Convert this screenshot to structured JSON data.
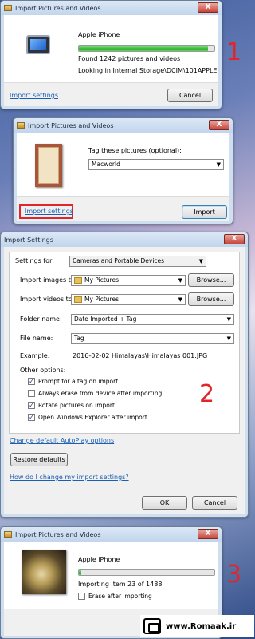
{
  "dialog1": {
    "title": "Import Pictures and Videos",
    "close": "X",
    "device": "Apple iPhone",
    "progress": 0.95,
    "found": "Found 1242 pictures and videos",
    "looking": "Looking in Internal Storage\\DCIM\\101APPLE",
    "import_settings": "Import settings",
    "cancel": "Cancel",
    "step": "1"
  },
  "dialog2": {
    "title": "Import Pictures and Videos",
    "close": "X",
    "tag_label": "Tag these pictures (optional):",
    "tag_value": "Macworld",
    "import_settings": "Import settings",
    "import": "Import",
    "highlight_color": "#e0262b"
  },
  "dialog3": {
    "title": "Import Settings",
    "close": "X",
    "settings_for_label": "Settings for:",
    "settings_for_value": "Cameras and Portable Devices",
    "import_images_label": "Import images to:",
    "import_images_value": "My Pictures",
    "import_videos_label": "Import videos to:",
    "import_videos_value": "My Pictures",
    "browse": "Browse...",
    "folder_name_label": "Folder name:",
    "folder_name_value": "Date Imported + Tag",
    "file_name_label": "File name:",
    "file_name_value": "Tag",
    "example_label": "Example:",
    "example_value": "2016-02-02 Himalayas\\Himalayas 001.JPG",
    "other_options": "Other options:",
    "options": [
      {
        "label": "Prompt for a tag on import",
        "checked": true
      },
      {
        "label": "Always erase from device after importing",
        "checked": false
      },
      {
        "label": "Rotate pictures on import",
        "checked": true
      },
      {
        "label": "Open Windows Explorer after import",
        "checked": true
      }
    ],
    "autoplay_link": "Change default AutoPlay options",
    "restore": "Restore defaults",
    "help_link": "How do I change my import settings?",
    "ok": "OK",
    "cancel": "Cancel",
    "step": "2"
  },
  "dialog4": {
    "title": "Import Pictures and Videos",
    "close": "X",
    "device": "Apple iPhone",
    "progress": 0.02,
    "importing": "Importing item 23 of 1488",
    "erase": "Erase after importing",
    "step": "3"
  },
  "watermark": {
    "site": "www.Romaak.ir"
  }
}
